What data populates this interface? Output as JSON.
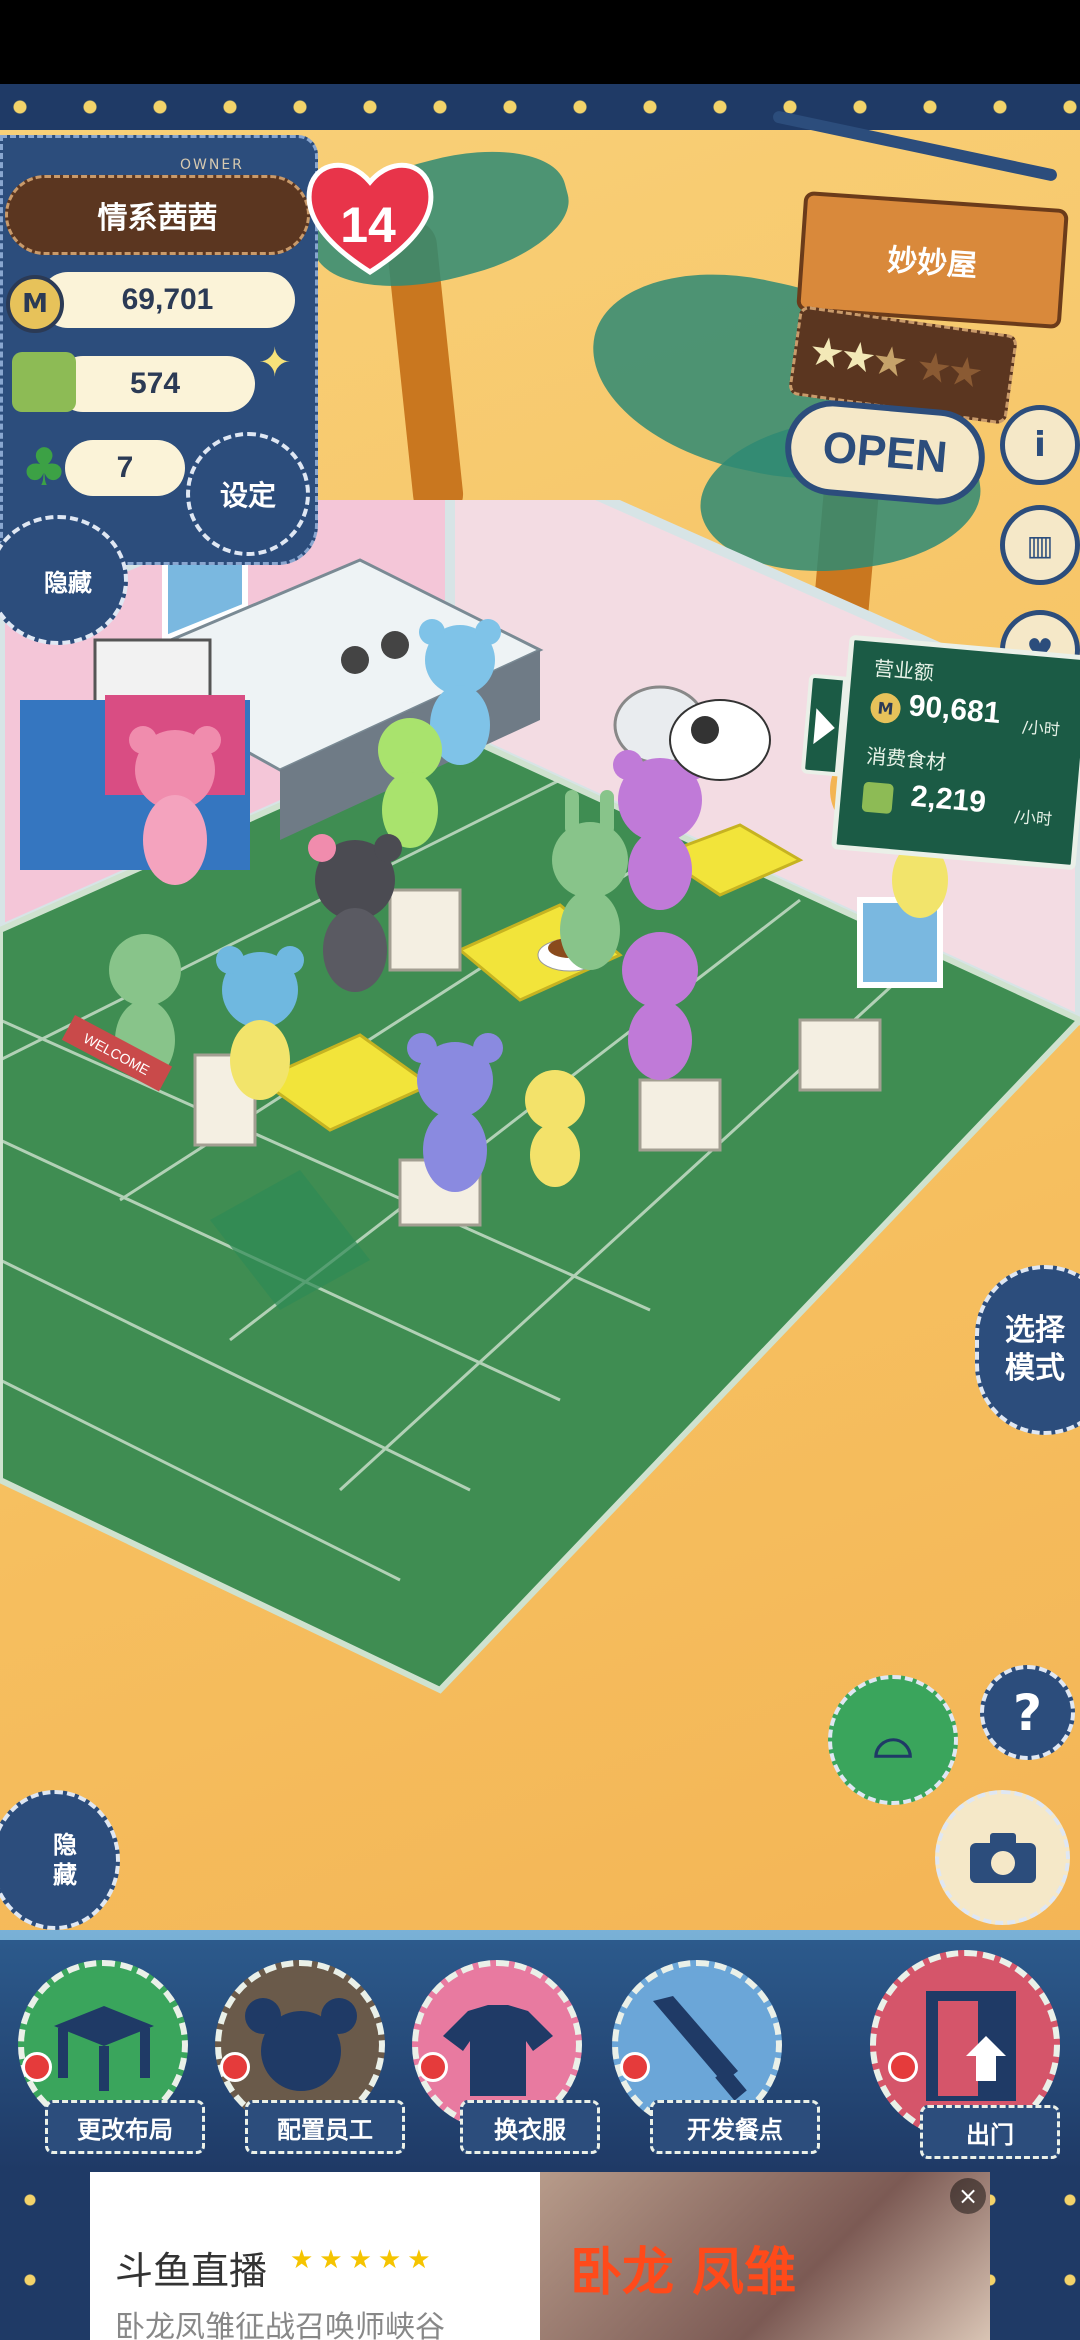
{
  "player": {
    "owner_label": "OWNER",
    "name": "情系茜茜",
    "level": "14",
    "coins": "69,701",
    "ingredients": "574",
    "clovers": "7"
  },
  "buttons": {
    "settings": "设定",
    "hide_top": "隐藏",
    "hide_bottom": "隐藏",
    "select_mode": "选择模式",
    "help": "?"
  },
  "shop": {
    "name": "妙妙屋",
    "status": "OPEN",
    "rating_stars": 2.5,
    "rating_max": 5
  },
  "income": {
    "revenue_label": "营业额",
    "revenue_value": "90,681",
    "revenue_unit": "/小时",
    "consumption_label": "消费食材",
    "consumption_value": "2,219",
    "consumption_unit": "/小时"
  },
  "scene": {
    "welcome_mat": "WELCOME"
  },
  "menu": [
    {
      "label": "更改布局",
      "icon": "table-icon"
    },
    {
      "label": "配置员工",
      "icon": "bear-head-icon"
    },
    {
      "label": "换衣服",
      "icon": "shirt-icon"
    },
    {
      "label": "开发餐点",
      "icon": "knife-icon"
    },
    {
      "label": "出门",
      "icon": "door-icon"
    }
  ],
  "ad": {
    "title": "斗鱼直播",
    "subtitle": "卧龙凤雏征战召唤师峡谷",
    "image_text": "卧龙 凤雏",
    "close": "×"
  },
  "colors": {
    "panel_blue": "#2c4d7c",
    "wood": "#d9893b",
    "board_green": "#1b5b45",
    "heart_red": "#e8344a",
    "floor_green": "#3f8d52"
  }
}
